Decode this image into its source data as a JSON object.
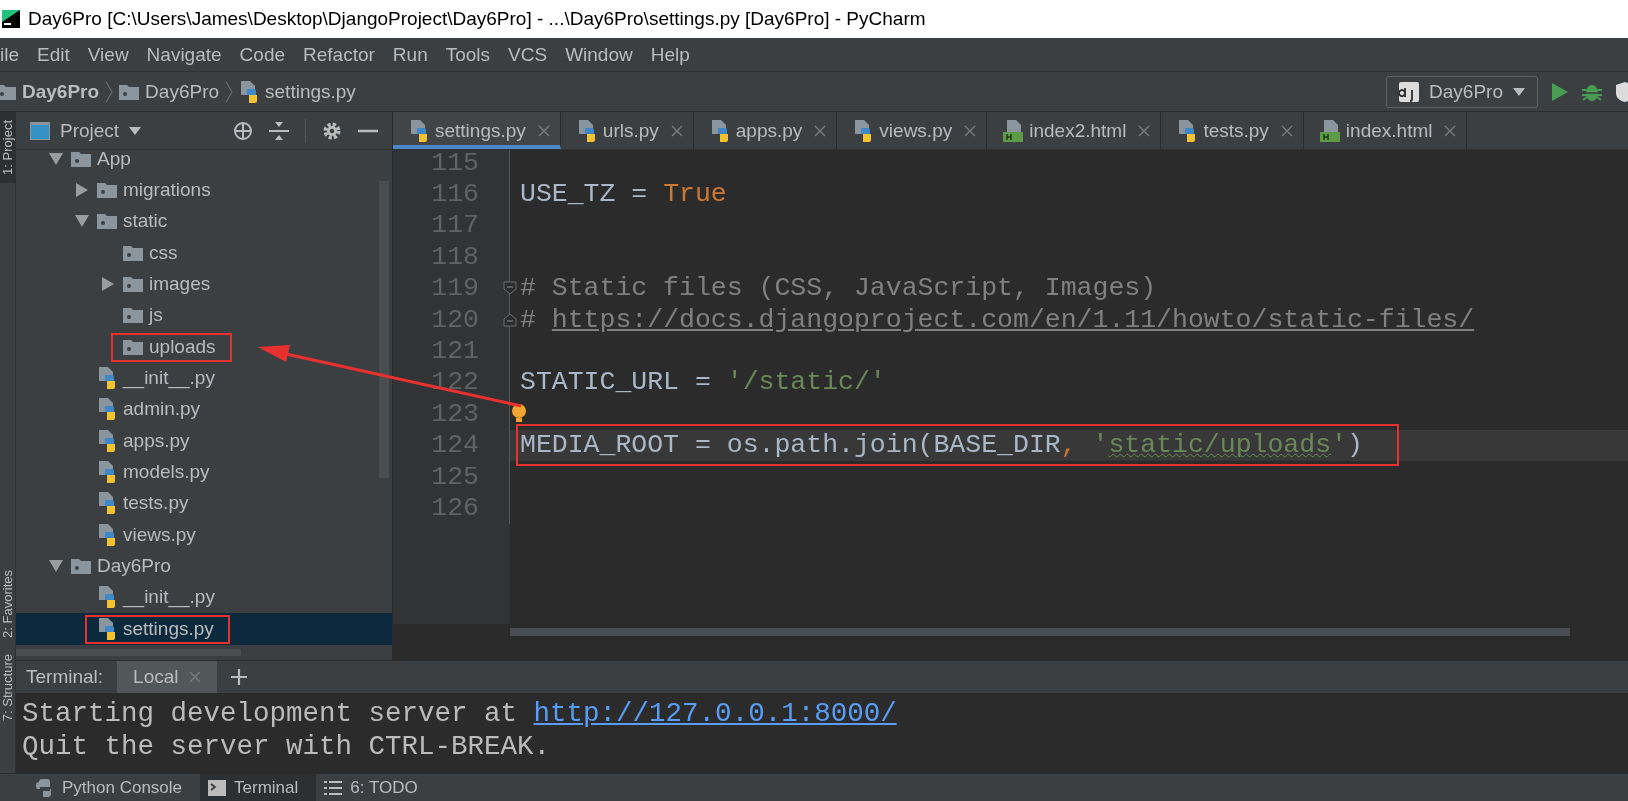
{
  "window": {
    "title": "Day6Pro [C:\\Users\\James\\Desktop\\DjangoProject\\Day6Pro] - ...\\Day6Pro\\settings.py [Day6Pro] - PyCharm"
  },
  "menu": [
    {
      "label": "ile"
    },
    {
      "label": "Edit"
    },
    {
      "label": "View"
    },
    {
      "label": "Navigate"
    },
    {
      "label": "Code"
    },
    {
      "label": "Refactor"
    },
    {
      "label": "Run"
    },
    {
      "label": "Tools"
    },
    {
      "label": "VCS"
    },
    {
      "label": "Window"
    },
    {
      "label": "Help"
    }
  ],
  "breadcrumbs": [
    {
      "kind": "project",
      "label": "Day6Pro"
    },
    {
      "kind": "folder",
      "label": "Day6Pro"
    },
    {
      "kind": "python",
      "label": "settings.py"
    }
  ],
  "run_config": {
    "label": "Day6Pro"
  },
  "left_strip": [
    {
      "label": "1: Project",
      "selected": true
    },
    {
      "label": "2: Favorites",
      "selected": false
    },
    {
      "label": "7: Structure",
      "selected": false
    }
  ],
  "project_panel": {
    "title": "Project",
    "tree": [
      {
        "kind": "folder",
        "label": "App",
        "expanded": true,
        "selected": false,
        "highlighted": false,
        "children": [
          {
            "kind": "folder",
            "label": "migrations",
            "expanded": false,
            "selected": false,
            "highlighted": false
          },
          {
            "kind": "folder",
            "label": "static",
            "expanded": true,
            "selected": false,
            "highlighted": false,
            "children": [
              {
                "kind": "folder",
                "label": "css",
                "selected": false,
                "highlighted": false
              },
              {
                "kind": "folder",
                "label": "images",
                "expanded": false,
                "selected": false,
                "highlighted": false
              },
              {
                "kind": "folder",
                "label": "js",
                "selected": false,
                "highlighted": false
              },
              {
                "kind": "folder",
                "label": "uploads",
                "selected": false,
                "highlighted": true
              }
            ]
          },
          {
            "kind": "python",
            "label": "__init__.py",
            "selected": false,
            "highlighted": false
          },
          {
            "kind": "python",
            "label": "admin.py",
            "selected": false,
            "highlighted": false
          },
          {
            "kind": "python",
            "label": "apps.py",
            "selected": false,
            "highlighted": false
          },
          {
            "kind": "python",
            "label": "models.py",
            "selected": false,
            "highlighted": false
          },
          {
            "kind": "python",
            "label": "tests.py",
            "selected": false,
            "highlighted": false
          },
          {
            "kind": "python",
            "label": "views.py",
            "selected": false,
            "highlighted": false
          }
        ]
      },
      {
        "kind": "folder",
        "label": "Day6Pro",
        "expanded": true,
        "selected": false,
        "highlighted": false,
        "children": [
          {
            "kind": "python",
            "label": "__init__.py",
            "selected": false,
            "highlighted": false
          },
          {
            "kind": "python",
            "label": "settings.py",
            "selected": true,
            "highlighted": true
          }
        ]
      }
    ]
  },
  "editor": {
    "tabs": [
      {
        "kind": "python",
        "label": "settings.py",
        "selected": true
      },
      {
        "kind": "python",
        "label": "urls.py",
        "selected": false
      },
      {
        "kind": "python",
        "label": "apps.py",
        "selected": false
      },
      {
        "kind": "python",
        "label": "views.py",
        "selected": false
      },
      {
        "kind": "html",
        "label": "index2.html",
        "selected": false
      },
      {
        "kind": "python",
        "label": "tests.py",
        "selected": false
      },
      {
        "kind": "html",
        "label": "index.html",
        "selected": false
      }
    ],
    "lines": [
      {
        "number": "115",
        "current": false,
        "highlighted": false,
        "bulb": false,
        "fold_start": false,
        "fold_end": false
      },
      {
        "number": "116",
        "current": false,
        "highlighted": false,
        "bulb": false,
        "fold_start": false,
        "fold_end": false,
        "tokens": [
          {
            "kind": "plain",
            "text": "USE_TZ = "
          },
          {
            "kind": "keyword",
            "text": "True"
          }
        ]
      },
      {
        "number": "117",
        "current": false,
        "highlighted": false,
        "bulb": false,
        "fold_start": false,
        "fold_end": false
      },
      {
        "number": "118",
        "current": false,
        "highlighted": false,
        "bulb": false,
        "fold_start": false,
        "fold_end": false
      },
      {
        "number": "119",
        "current": false,
        "highlighted": false,
        "bulb": false,
        "fold_start": true,
        "fold_end": false,
        "tokens": [
          {
            "kind": "comment",
            "text": "# Static files (CSS, JavaScript, Images)"
          }
        ]
      },
      {
        "number": "120",
        "current": false,
        "highlighted": false,
        "bulb": false,
        "fold_start": false,
        "fold_end": true,
        "tokens": [
          {
            "kind": "comment",
            "text": "# "
          },
          {
            "kind": "comment-link",
            "text": "https://docs.djangoproject.com/en/1.11/howto/static-files/"
          }
        ]
      },
      {
        "number": "121",
        "current": false,
        "highlighted": false,
        "bulb": false,
        "fold_start": false,
        "fold_end": false
      },
      {
        "number": "122",
        "current": false,
        "highlighted": false,
        "bulb": false,
        "fold_start": false,
        "fold_end": false,
        "tokens": [
          {
            "kind": "plain",
            "text": "STATIC_URL = "
          },
          {
            "kind": "string",
            "text": "'/static/'"
          }
        ]
      },
      {
        "number": "123",
        "current": false,
        "highlighted": false,
        "bulb": true,
        "fold_start": false,
        "fold_end": false
      },
      {
        "number": "124",
        "current": true,
        "highlighted": true,
        "bulb": false,
        "fold_start": false,
        "fold_end": false,
        "tokens": [
          {
            "kind": "plain",
            "text": "MEDIA_ROOT = os.path.join(BASE_DIR"
          },
          {
            "kind": "keyword",
            "text": ","
          },
          {
            "kind": "string",
            "text": " '"
          },
          {
            "kind": "string-typo",
            "text": "static/uploads"
          },
          {
            "kind": "string",
            "text": "'"
          },
          {
            "kind": "plain",
            "text": ")"
          }
        ]
      },
      {
        "number": "125",
        "current": false,
        "highlighted": false,
        "bulb": false,
        "fold_start": false,
        "fold_end": false
      },
      {
        "number": "126",
        "current": false,
        "highlighted": false,
        "bulb": false,
        "fold_start": false,
        "fold_end": false
      }
    ]
  },
  "terminal": {
    "label": "Terminal:",
    "tabs": [
      {
        "label": "Local",
        "selected": true
      }
    ],
    "lines": [
      {
        "segments": [
          {
            "kind": "text",
            "text": "Starting development server at "
          },
          {
            "kind": "link",
            "text": "http://127.0.0.1:8000/"
          }
        ]
      },
      {
        "segments": [
          {
            "kind": "text",
            "text": "Quit the server with CTRL-BREAK."
          }
        ]
      }
    ]
  },
  "bottom_bar": [
    {
      "kind": "python",
      "label": "Python Console",
      "selected": false
    },
    {
      "kind": "terminal",
      "label": "Terminal",
      "selected": true
    },
    {
      "kind": "todo",
      "label": "6: TODO",
      "selected": false
    }
  ],
  "annotation_arrow": true
}
